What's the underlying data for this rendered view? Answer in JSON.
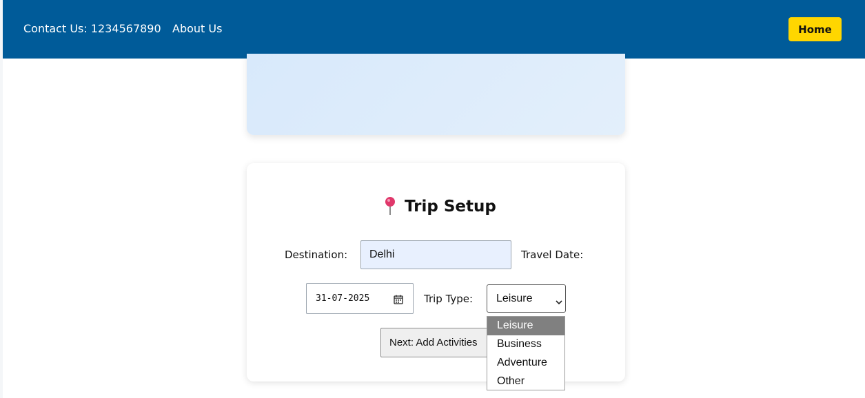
{
  "nav": {
    "contact": "Contact Us: 1234567890",
    "about": "About Us",
    "home": "Home"
  },
  "trip_setup": {
    "title": "Trip Setup",
    "title_icon": "round-pushpin-icon",
    "destination_label": "Destination:",
    "destination_value": "Delhi",
    "travel_date_label": "Travel Date:",
    "travel_date_value": "31-07-2025",
    "trip_type_label": "Trip Type:",
    "trip_type_value": "Leisure",
    "trip_type_options": [
      "Leisure",
      "Business",
      "Adventure",
      "Other"
    ],
    "next_button": "Next: Add Activities"
  },
  "colors": {
    "navbar": "#005b99",
    "home_button": "#ffd600",
    "destination_field": "#e8f0fe",
    "selected_option": "#808080"
  }
}
